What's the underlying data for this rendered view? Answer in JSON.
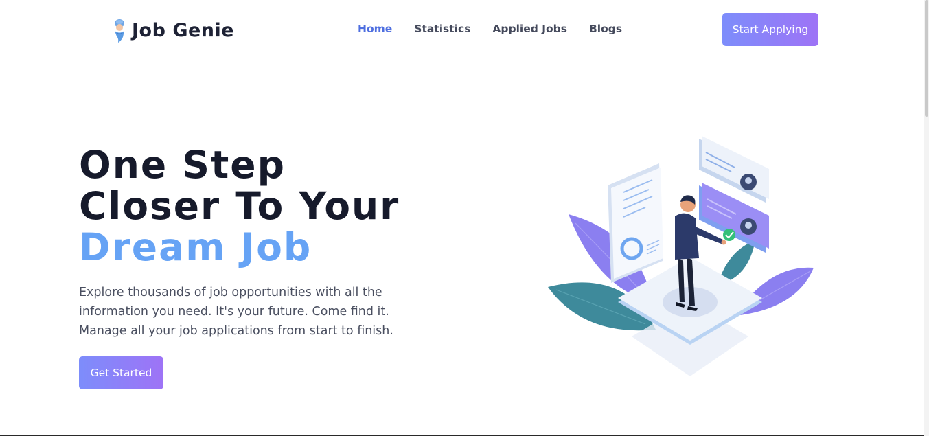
{
  "brand": {
    "name": "Job Genie",
    "logo_icon": "genie-icon"
  },
  "nav": {
    "items": [
      {
        "label": "Home",
        "active": true
      },
      {
        "label": "Statistics",
        "active": false
      },
      {
        "label": "Applied Jobs",
        "active": false
      },
      {
        "label": "Blogs",
        "active": false
      }
    ],
    "cta_label": "Start Applying"
  },
  "hero": {
    "title_line1": "One Step",
    "title_line2": "Closer To Your",
    "title_line3": "Dream Job",
    "description": "Explore thousands of job opportunities with all the information you need. It's your future. Come find it. Manage all your job applications from start to finish.",
    "cta_label": "Get Started",
    "illustration": "job-seeker-illustration"
  },
  "colors": {
    "accent": "#66a3f5",
    "nav_active": "#4f6fe0",
    "button_gradient_start": "#7d8dfb",
    "button_gradient_end": "#9e73f6",
    "heading": "#161a2b"
  }
}
